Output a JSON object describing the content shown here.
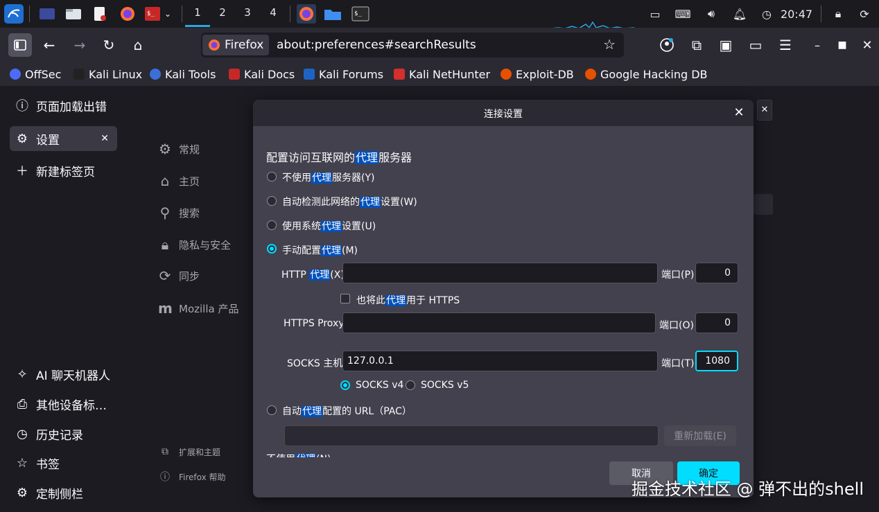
{
  "taskbar": {
    "workspaces": [
      "1",
      "2",
      "3",
      "4"
    ],
    "active_workspace": 0,
    "clock": "20:47"
  },
  "browser": {
    "identity_label": "Firefox",
    "url": "about:preferences#searchResults"
  },
  "bookmarks": [
    {
      "label": "OffSec",
      "color": "#4a6cf7"
    },
    {
      "label": "Kali Linux",
      "color": "#222222"
    },
    {
      "label": "Kali Tools",
      "color": "#3b6fd8"
    },
    {
      "label": "Kali Docs",
      "color": "#c62828"
    },
    {
      "label": "Kali Forums",
      "color": "#1e63c4"
    },
    {
      "label": "Kali NetHunter",
      "color": "#d32f2f"
    },
    {
      "label": "Exploit-DB",
      "color": "#e65100"
    },
    {
      "label": "Google Hacking DB",
      "color": "#e65100"
    }
  ],
  "sidebar": {
    "items": [
      {
        "label": "页面加载出错",
        "icon": "info-icon"
      },
      {
        "label": "设置",
        "icon": "gear-icon"
      },
      {
        "label": "新建标签页",
        "icon": "plus-icon"
      }
    ],
    "bottom_items": [
      {
        "label": "AI 聊天机器人",
        "icon": "sparkle-icon"
      },
      {
        "label": "其他设备标…",
        "icon": "devices-icon"
      },
      {
        "label": "历史记录",
        "icon": "clock-icon"
      },
      {
        "label": "书签",
        "icon": "star-icon"
      },
      {
        "label": "定制侧栏",
        "icon": "gear-icon"
      }
    ]
  },
  "prefs": {
    "categories": [
      {
        "label": "常规",
        "icon": "gear-icon"
      },
      {
        "label": "主页",
        "icon": "home-icon"
      },
      {
        "label": "搜索",
        "icon": "search-icon"
      },
      {
        "label": "隐私与安全",
        "icon": "lock-icon"
      },
      {
        "label": "同步",
        "icon": "sync-icon"
      },
      {
        "label": "Mozilla 产品",
        "icon": "mozilla-icon"
      }
    ],
    "footer": [
      {
        "label": "扩展和主题",
        "icon": "puzzle-icon"
      },
      {
        "label": "Firefox 帮助",
        "icon": "help-icon"
      }
    ]
  },
  "dialog": {
    "title": "连接设置",
    "heading_pre": "配置访问互联网的",
    "heading_hl": "代理",
    "heading_post": "服务器",
    "no_proxy_pre": "不使用",
    "no_proxy_post": "服务器(Y)",
    "auto_detect_pre": "自动检测此网络的",
    "auto_detect_post": "设置(W)",
    "system_pre": "使用系统",
    "system_post": "设置(U)",
    "manual_pre": "手动配置",
    "manual_post": "(M)",
    "hl_word": "代理",
    "http_label_pre": "HTTP ",
    "http_label_post": "(X)",
    "http_host": "",
    "port_p_label": "端口(P)",
    "http_port": "0",
    "also_https_pre": "也将此",
    "also_https_post": "用于 HTTPS",
    "https_label": "HTTPS Proxy",
    "https_host": "",
    "port_o_label": "端口(O)",
    "https_port": "0",
    "socks_label": "SOCKS 主机",
    "socks_host": "127.0.0.1",
    "port_t_label": "端口(T)",
    "socks_port": "1080",
    "socks_v4": "SOCKS v4",
    "socks_v5": "SOCKS v5",
    "pac_pre": "自动",
    "pac_post": "配置的 URL（PAC）",
    "pac_url": "",
    "reload_label": "重新加载(E)",
    "cut_text_pre": "不使用",
    "cut_text_post": "(N)",
    "cancel_label": "取消",
    "ok_label": "确定"
  },
  "watermark": "掘金技术社区 @ 弹不出的shell"
}
